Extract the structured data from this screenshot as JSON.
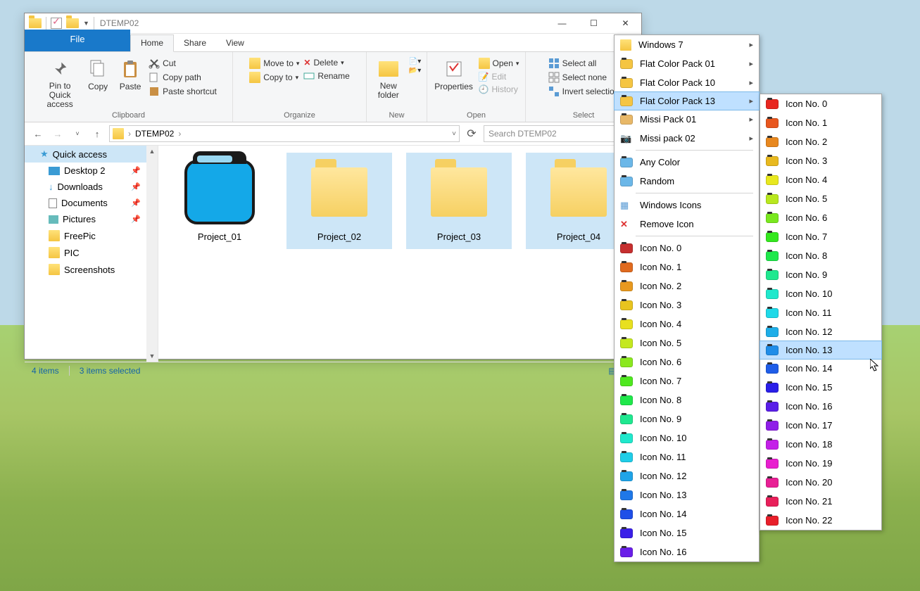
{
  "window": {
    "title": "DTEMP02",
    "tabs": {
      "file": "File",
      "home": "Home",
      "share": "Share",
      "view": "View"
    },
    "winControls": {
      "min": "—",
      "max": "☐",
      "close": "✕"
    }
  },
  "ribbon": {
    "clipboard": {
      "label": "Clipboard",
      "pin": "Pin to Quick access",
      "copy": "Copy",
      "paste": "Paste",
      "cut": "Cut",
      "copyPath": "Copy path",
      "pasteShortcut": "Paste shortcut"
    },
    "organize": {
      "label": "Organize",
      "moveTo": "Move to",
      "copyTo": "Copy to",
      "delete": "Delete",
      "rename": "Rename"
    },
    "new": {
      "label": "New",
      "newFolder": "New folder"
    },
    "open": {
      "label": "Open",
      "properties": "Properties",
      "open": "Open",
      "edit": "Edit",
      "history": "History"
    },
    "select": {
      "label": "Select",
      "selectAll": "Select all",
      "selectNone": "Select none",
      "invert": "Invert selection"
    }
  },
  "addressbar": {
    "path": "DTEMP02",
    "searchPlaceholder": "Search DTEMP02"
  },
  "sidebar": {
    "items": [
      {
        "label": "Quick access",
        "selected": true,
        "icon": "star"
      },
      {
        "label": "Desktop 2",
        "pinned": true,
        "icon": "desktop"
      },
      {
        "label": "Downloads",
        "pinned": true,
        "icon": "download"
      },
      {
        "label": "Documents",
        "pinned": true,
        "icon": "document"
      },
      {
        "label": "Pictures",
        "pinned": true,
        "icon": "picture"
      },
      {
        "label": "FreePic",
        "icon": "folder"
      },
      {
        "label": "PIC",
        "icon": "folder"
      },
      {
        "label": "Screenshots",
        "icon": "folder"
      }
    ]
  },
  "files": [
    {
      "name": "Project_01",
      "selected": false,
      "icon": "blue"
    },
    {
      "name": "Project_02",
      "selected": true,
      "icon": "std"
    },
    {
      "name": "Project_03",
      "selected": true,
      "icon": "std"
    },
    {
      "name": "Project_04",
      "selected": true,
      "icon": "std"
    }
  ],
  "statusbar": {
    "items": "4 items",
    "selected": "3 items selected"
  },
  "contextMenu1": {
    "packs": [
      {
        "label": "Windows 7",
        "sub": true
      },
      {
        "label": "Flat Color Pack 01",
        "sub": true
      },
      {
        "label": "Flat Color Pack 10",
        "sub": true
      },
      {
        "label": "Flat Color Pack 13",
        "sub": true,
        "highlight": true
      },
      {
        "label": "Missi Pack 01",
        "sub": true
      },
      {
        "label": "Missi pack 02",
        "sub": true
      }
    ],
    "anyColor": "Any Color",
    "random": "Random",
    "windowsIcons": "Windows Icons",
    "removeIcon": "Remove Icon",
    "icons": [
      {
        "label": "Icon No. 0",
        "color": "#c62f2f"
      },
      {
        "label": "Icon No. 1",
        "color": "#e06a1f"
      },
      {
        "label": "Icon No. 2",
        "color": "#e8991f"
      },
      {
        "label": "Icon No. 3",
        "color": "#e8c41f"
      },
      {
        "label": "Icon No. 4",
        "color": "#e8e01f"
      },
      {
        "label": "Icon No. 5",
        "color": "#c4e81f"
      },
      {
        "label": "Icon No. 6",
        "color": "#8be81f"
      },
      {
        "label": "Icon No. 7",
        "color": "#4fe81f"
      },
      {
        "label": "Icon No. 8",
        "color": "#1fe84b"
      },
      {
        "label": "Icon No. 9",
        "color": "#1fe890"
      },
      {
        "label": "Icon No. 10",
        "color": "#1fe8cc"
      },
      {
        "label": "Icon No. 11",
        "color": "#1fcde8"
      },
      {
        "label": "Icon No. 12",
        "color": "#1fa4e8"
      },
      {
        "label": "Icon No. 13",
        "color": "#1f78e8"
      },
      {
        "label": "Icon No. 14",
        "color": "#1f4fe8"
      },
      {
        "label": "Icon No. 15",
        "color": "#3a1fe8"
      },
      {
        "label": "Icon No. 16",
        "color": "#6a1fe8"
      }
    ]
  },
  "contextMenu2": {
    "highlightIndex": 13,
    "icons": [
      {
        "label": "Icon No. 0",
        "color": "#e8261f"
      },
      {
        "label": "Icon No. 1",
        "color": "#e8571f"
      },
      {
        "label": "Icon No. 2",
        "color": "#e8881f"
      },
      {
        "label": "Icon No. 3",
        "color": "#e8b91f"
      },
      {
        "label": "Icon No. 4",
        "color": "#e8e81f"
      },
      {
        "label": "Icon No. 5",
        "color": "#b9e81f"
      },
      {
        "label": "Icon No. 6",
        "color": "#7ae81f"
      },
      {
        "label": "Icon No. 7",
        "color": "#34e81f"
      },
      {
        "label": "Icon No. 8",
        "color": "#1fe84b"
      },
      {
        "label": "Icon No. 9",
        "color": "#1fe88f"
      },
      {
        "label": "Icon No. 10",
        "color": "#1fe8cc"
      },
      {
        "label": "Icon No. 11",
        "color": "#1fd9e8"
      },
      {
        "label": "Icon No. 12",
        "color": "#1faee8"
      },
      {
        "label": "Icon No. 13",
        "color": "#1f8de8"
      },
      {
        "label": "Icon No. 14",
        "color": "#1f5de8"
      },
      {
        "label": "Icon No. 15",
        "color": "#2a1fe8"
      },
      {
        "label": "Icon No. 16",
        "color": "#5a1fe8"
      },
      {
        "label": "Icon No. 17",
        "color": "#8f1fe8"
      },
      {
        "label": "Icon No. 18",
        "color": "#c41fe8"
      },
      {
        "label": "Icon No. 19",
        "color": "#e81fcf"
      },
      {
        "label": "Icon No. 20",
        "color": "#e81f95"
      },
      {
        "label": "Icon No. 21",
        "color": "#e81f5a"
      },
      {
        "label": "Icon No. 22",
        "color": "#e81f2a"
      }
    ]
  }
}
